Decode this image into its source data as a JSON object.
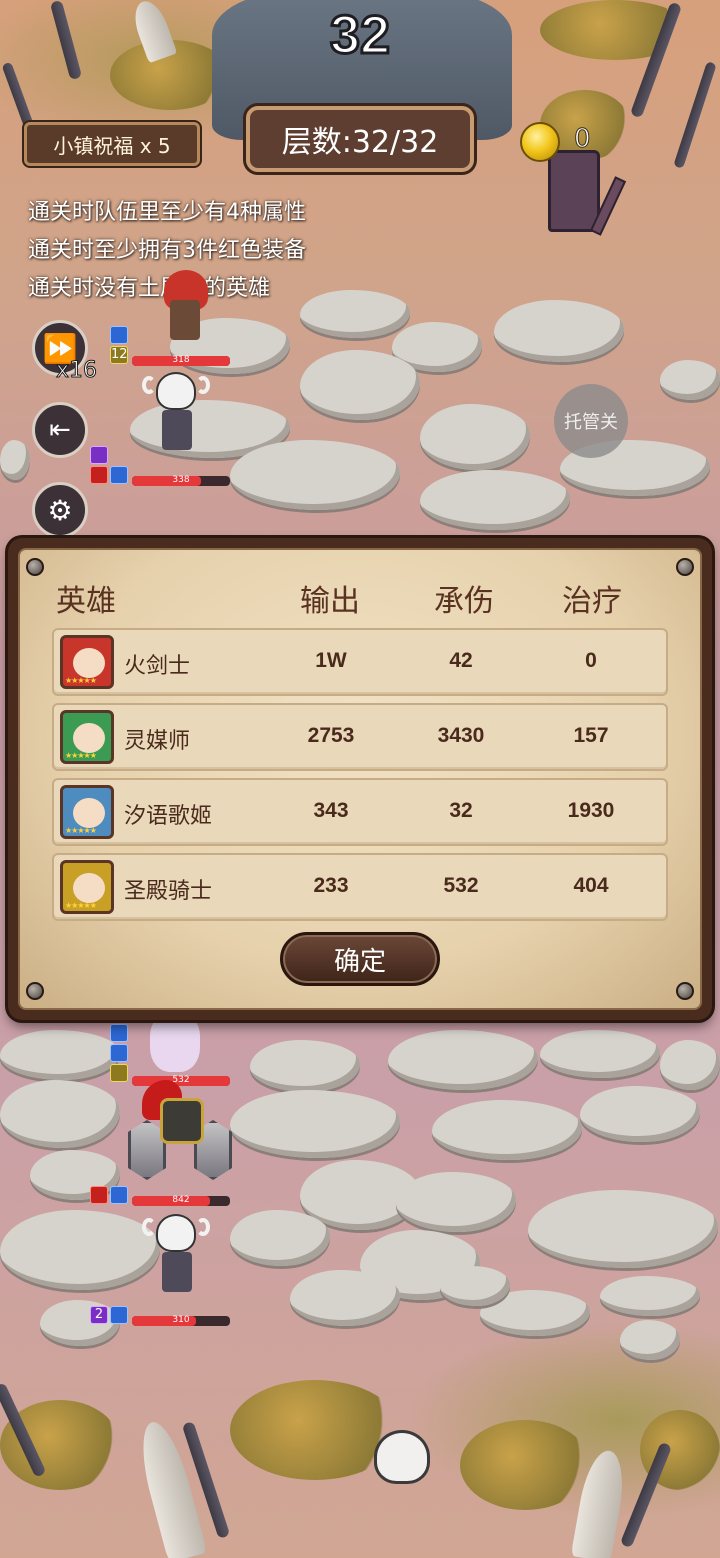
{
  "hud": {
    "turn_counter": "32",
    "blessing_label": "小镇祝福 x 5",
    "floor_label": "层数:32/32",
    "gold_amount": "0"
  },
  "objectives": [
    "通关时队伍里至少有4种属性",
    "通关时至少拥有3件红色装备",
    "通关时没有土属性的英雄"
  ],
  "controls": {
    "speed_label": "x16",
    "auto_label": "托管关"
  },
  "battlefield": {
    "units": [
      {
        "hp_text": "318",
        "hp_fraction": 1.0,
        "level_badge": "12"
      },
      {
        "hp_text": "338",
        "hp_fraction": 0.7
      },
      {
        "hp_text": "532",
        "hp_fraction": 1.0
      },
      {
        "hp_text": "842",
        "hp_fraction": 0.8
      },
      {
        "hp_text": "310",
        "hp_fraction": 0.65,
        "level_badge": "2"
      }
    ]
  },
  "results": {
    "headers": [
      "英雄",
      "输出",
      "承伤",
      "治疗"
    ],
    "rows": [
      {
        "hero": "火剑士",
        "damage": "1W",
        "taken": "42",
        "heal": "0",
        "color": "#c8362b"
      },
      {
        "hero": "灵媒师",
        "damage": "2753",
        "taken": "3430",
        "heal": "157",
        "color": "#3b9b52"
      },
      {
        "hero": "汐语歌姬",
        "damage": "343",
        "taken": "32",
        "heal": "1930",
        "color": "#4e8bbf"
      },
      {
        "hero": "圣殿骑士",
        "damage": "233",
        "taken": "532",
        "heal": "404",
        "color": "#c9a026"
      }
    ],
    "confirm_label": "确定"
  }
}
